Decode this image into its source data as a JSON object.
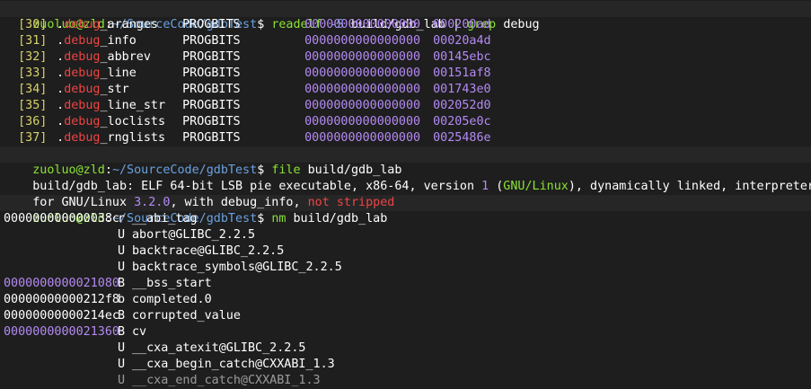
{
  "prompt": {
    "user_host": "zuoluo@zld",
    "sep": ":",
    "path": "~/SourceCode/gdbTest",
    "dollar": "$"
  },
  "commands": {
    "readelf": {
      "cmd": "readelf",
      "flag": "-S",
      "arg": "build/gdb_lab",
      "pipe": "|",
      "grep": "grep",
      "grep_arg": "debug"
    },
    "file": {
      "cmd": "file",
      "arg": "build/gdb_lab"
    },
    "nm": {
      "cmd": "nm",
      "arg": "build/gdb_lab"
    }
  },
  "sections": [
    {
      "idx": "[30]",
      "dot": ".",
      "hl": "debug",
      "rest": "_aranges",
      "type": "PROGBITS",
      "addr": "0000000000000000",
      "off": "000200ad"
    },
    {
      "idx": "[31]",
      "dot": ".",
      "hl": "debug",
      "rest": "_info",
      "type": "PROGBITS",
      "addr": "0000000000000000",
      "off": "00020a4d"
    },
    {
      "idx": "[32]",
      "dot": ".",
      "hl": "debug",
      "rest": "_abbrev",
      "type": "PROGBITS",
      "addr": "0000000000000000",
      "off": "00145ebc"
    },
    {
      "idx": "[33]",
      "dot": ".",
      "hl": "debug",
      "rest": "_line",
      "type": "PROGBITS",
      "addr": "0000000000000000",
      "off": "00151af8"
    },
    {
      "idx": "[34]",
      "dot": ".",
      "hl": "debug",
      "rest": "_str",
      "type": "PROGBITS",
      "addr": "0000000000000000",
      "off": "001743e0"
    },
    {
      "idx": "[35]",
      "dot": ".",
      "hl": "debug",
      "rest": "_line_str",
      "type": "PROGBITS",
      "addr": "0000000000000000",
      "off": "002052d0"
    },
    {
      "idx": "[36]",
      "dot": ".",
      "hl": "debug",
      "rest": "_loclists",
      "type": "PROGBITS",
      "addr": "0000000000000000",
      "off": "00205e0c"
    },
    {
      "idx": "[37]",
      "dot": ".",
      "hl": "debug",
      "rest": "_rnglists",
      "type": "PROGBITS",
      "addr": "0000000000000000",
      "off": "0025486e"
    }
  ],
  "file_output": {
    "l1_path": "build/gdb_lab",
    "l1_a": ": ELF 64-bit LSB pie executable, x86-64, version ",
    "l1_num": "1",
    "l1_b": " (",
    "l1_gnu": "GNU/Linux",
    "l1_c": "), dynamically linked, interpreter /lib",
    "l2_a": "for GNU/Linux ",
    "l2_ver": "3.2.0",
    "l2_b": ", with debug_info, ",
    "l2_ns": "not stripped"
  },
  "nm_rows": [
    {
      "addr": "000000000000038c",
      "addr_color": "white",
      "type": "r",
      "name": "__abi_tag"
    },
    {
      "addr": "",
      "addr_color": "white",
      "type": "U",
      "name": "abort@GLIBC_2.2.5"
    },
    {
      "addr": "",
      "addr_color": "white",
      "type": "U",
      "name": "backtrace@GLIBC_2.2.5"
    },
    {
      "addr": "",
      "addr_color": "white",
      "type": "U",
      "name": "backtrace_symbols@GLIBC_2.2.5"
    },
    {
      "addr": "0000000000021080",
      "addr_color": "purple",
      "type": "B",
      "name": "__bss_start"
    },
    {
      "addr": "00000000000212f8",
      "addr_color": "white",
      "type": "b",
      "name": "completed.0"
    },
    {
      "addr": "00000000000214ec",
      "addr_color": "white",
      "type": "B",
      "name": "corrupted_value"
    },
    {
      "addr": "0000000000021360",
      "addr_color": "purple",
      "type": "B",
      "name": "cv"
    },
    {
      "addr": "",
      "addr_color": "white",
      "type": "U",
      "name": "__cxa_atexit@GLIBC_2.2.5"
    },
    {
      "addr": "",
      "addr_color": "white",
      "type": "U",
      "name": "__cxa_begin_catch@CXXABI_1.3"
    },
    {
      "addr": "",
      "addr_color": "white",
      "type": "U",
      "name": "__cxa_end_catch@CXXABI_1.3"
    }
  ],
  "colors": {
    "background": "#1e1e1e",
    "prompt_user": "#8ae234",
    "prompt_path": "#6aa1e0",
    "debug_highlight": "#ef4444",
    "number": "#b48af4",
    "section_index": "#d8d26a"
  }
}
